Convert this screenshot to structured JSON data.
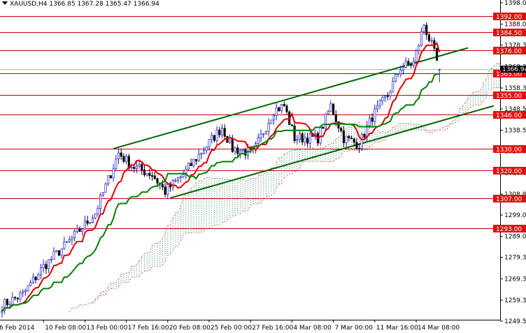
{
  "header": {
    "symbol": "XAUUSD,H4",
    "open": "1366.85",
    "high": "1367.28",
    "low": "1365.47",
    "close": "1366.94"
  },
  "chart_data": {
    "type": "candlestick",
    "title": "XAUUSD,H4",
    "ylim": [
      1249.55,
      1398.05
    ],
    "y_ticks": [
      "1398.05",
      "1388.05",
      "1378.30",
      "1368.30",
      "1358.30",
      "1348.55",
      "1338.55",
      "1328.80",
      "1318.80",
      "1308.80",
      "1299.05",
      "1289.05",
      "1279.30",
      "1269.30",
      "1259.30",
      "1249.55"
    ],
    "x_ticks": [
      {
        "bar": 0,
        "label": "6 Feb 2014"
      },
      {
        "bar": 16,
        "label": "10 Feb 08:00"
      },
      {
        "bar": 32,
        "label": "13 Feb 00:00"
      },
      {
        "bar": 48,
        "label": "17 Feb 16:00"
      },
      {
        "bar": 64,
        "label": "20 Feb 08:00"
      },
      {
        "bar": 80,
        "label": "25 Feb 00:00"
      },
      {
        "bar": 96,
        "label": "27 Feb 16:00"
      },
      {
        "bar": 112,
        "label": "4 Mar 08:00"
      },
      {
        "bar": 128,
        "label": "7 Mar 00:00"
      },
      {
        "bar": 144,
        "label": "11 Mar 16:00"
      },
      {
        "bar": 160,
        "label": "14 Mar 08:00"
      }
    ],
    "close_path": [
      [
        0,
        1257
      ],
      [
        8,
        1262
      ],
      [
        16,
        1275
      ],
      [
        27,
        1288
      ],
      [
        36,
        1300
      ],
      [
        45,
        1328
      ],
      [
        50,
        1322
      ],
      [
        58,
        1318
      ],
      [
        63,
        1310
      ],
      [
        70,
        1318
      ],
      [
        78,
        1330
      ],
      [
        85,
        1340
      ],
      [
        89,
        1330
      ],
      [
        97,
        1328
      ],
      [
        105,
        1348
      ],
      [
        109,
        1350
      ],
      [
        113,
        1335
      ],
      [
        122,
        1335
      ],
      [
        127,
        1350
      ],
      [
        132,
        1335
      ],
      [
        138,
        1332
      ],
      [
        143,
        1345
      ],
      [
        149,
        1355
      ],
      [
        154,
        1368
      ],
      [
        159,
        1370
      ],
      [
        163,
        1388
      ],
      [
        166,
        1378
      ],
      [
        169,
        1366.94
      ]
    ],
    "levels": [
      1392.0,
      1384.5,
      1376.0,
      1365.0,
      1355.0,
      1346.0,
      1330.0,
      1320.0,
      1307.0,
      1293.0
    ],
    "level_labels": [
      "1392.00",
      "1384.50",
      "1376.00",
      "1365.00",
      "1355.00",
      "1346.00",
      "1330.00",
      "1320.00",
      "1307.00",
      "1293.00"
    ],
    "current_price": "1366.94",
    "trendlines": [
      {
        "name": "upper-channel",
        "points": [
          [
            43,
            1330
          ],
          [
            180,
            1377
          ]
        ]
      },
      {
        "name": "lower-channel",
        "points": [
          [
            65,
            1307
          ],
          [
            190,
            1350
          ]
        ]
      }
    ],
    "indicators": [
      "Ichimoku tenkan (9)",
      "Ichimoku kijun (26)",
      "Ichimoku cloud (52, shift 26)"
    ],
    "colors": {
      "bull": "#2020c0",
      "bear": "#000000",
      "tenkan": "#e00000",
      "kijun": "#008000",
      "level": "#c00000",
      "trend": "#006400"
    }
  }
}
